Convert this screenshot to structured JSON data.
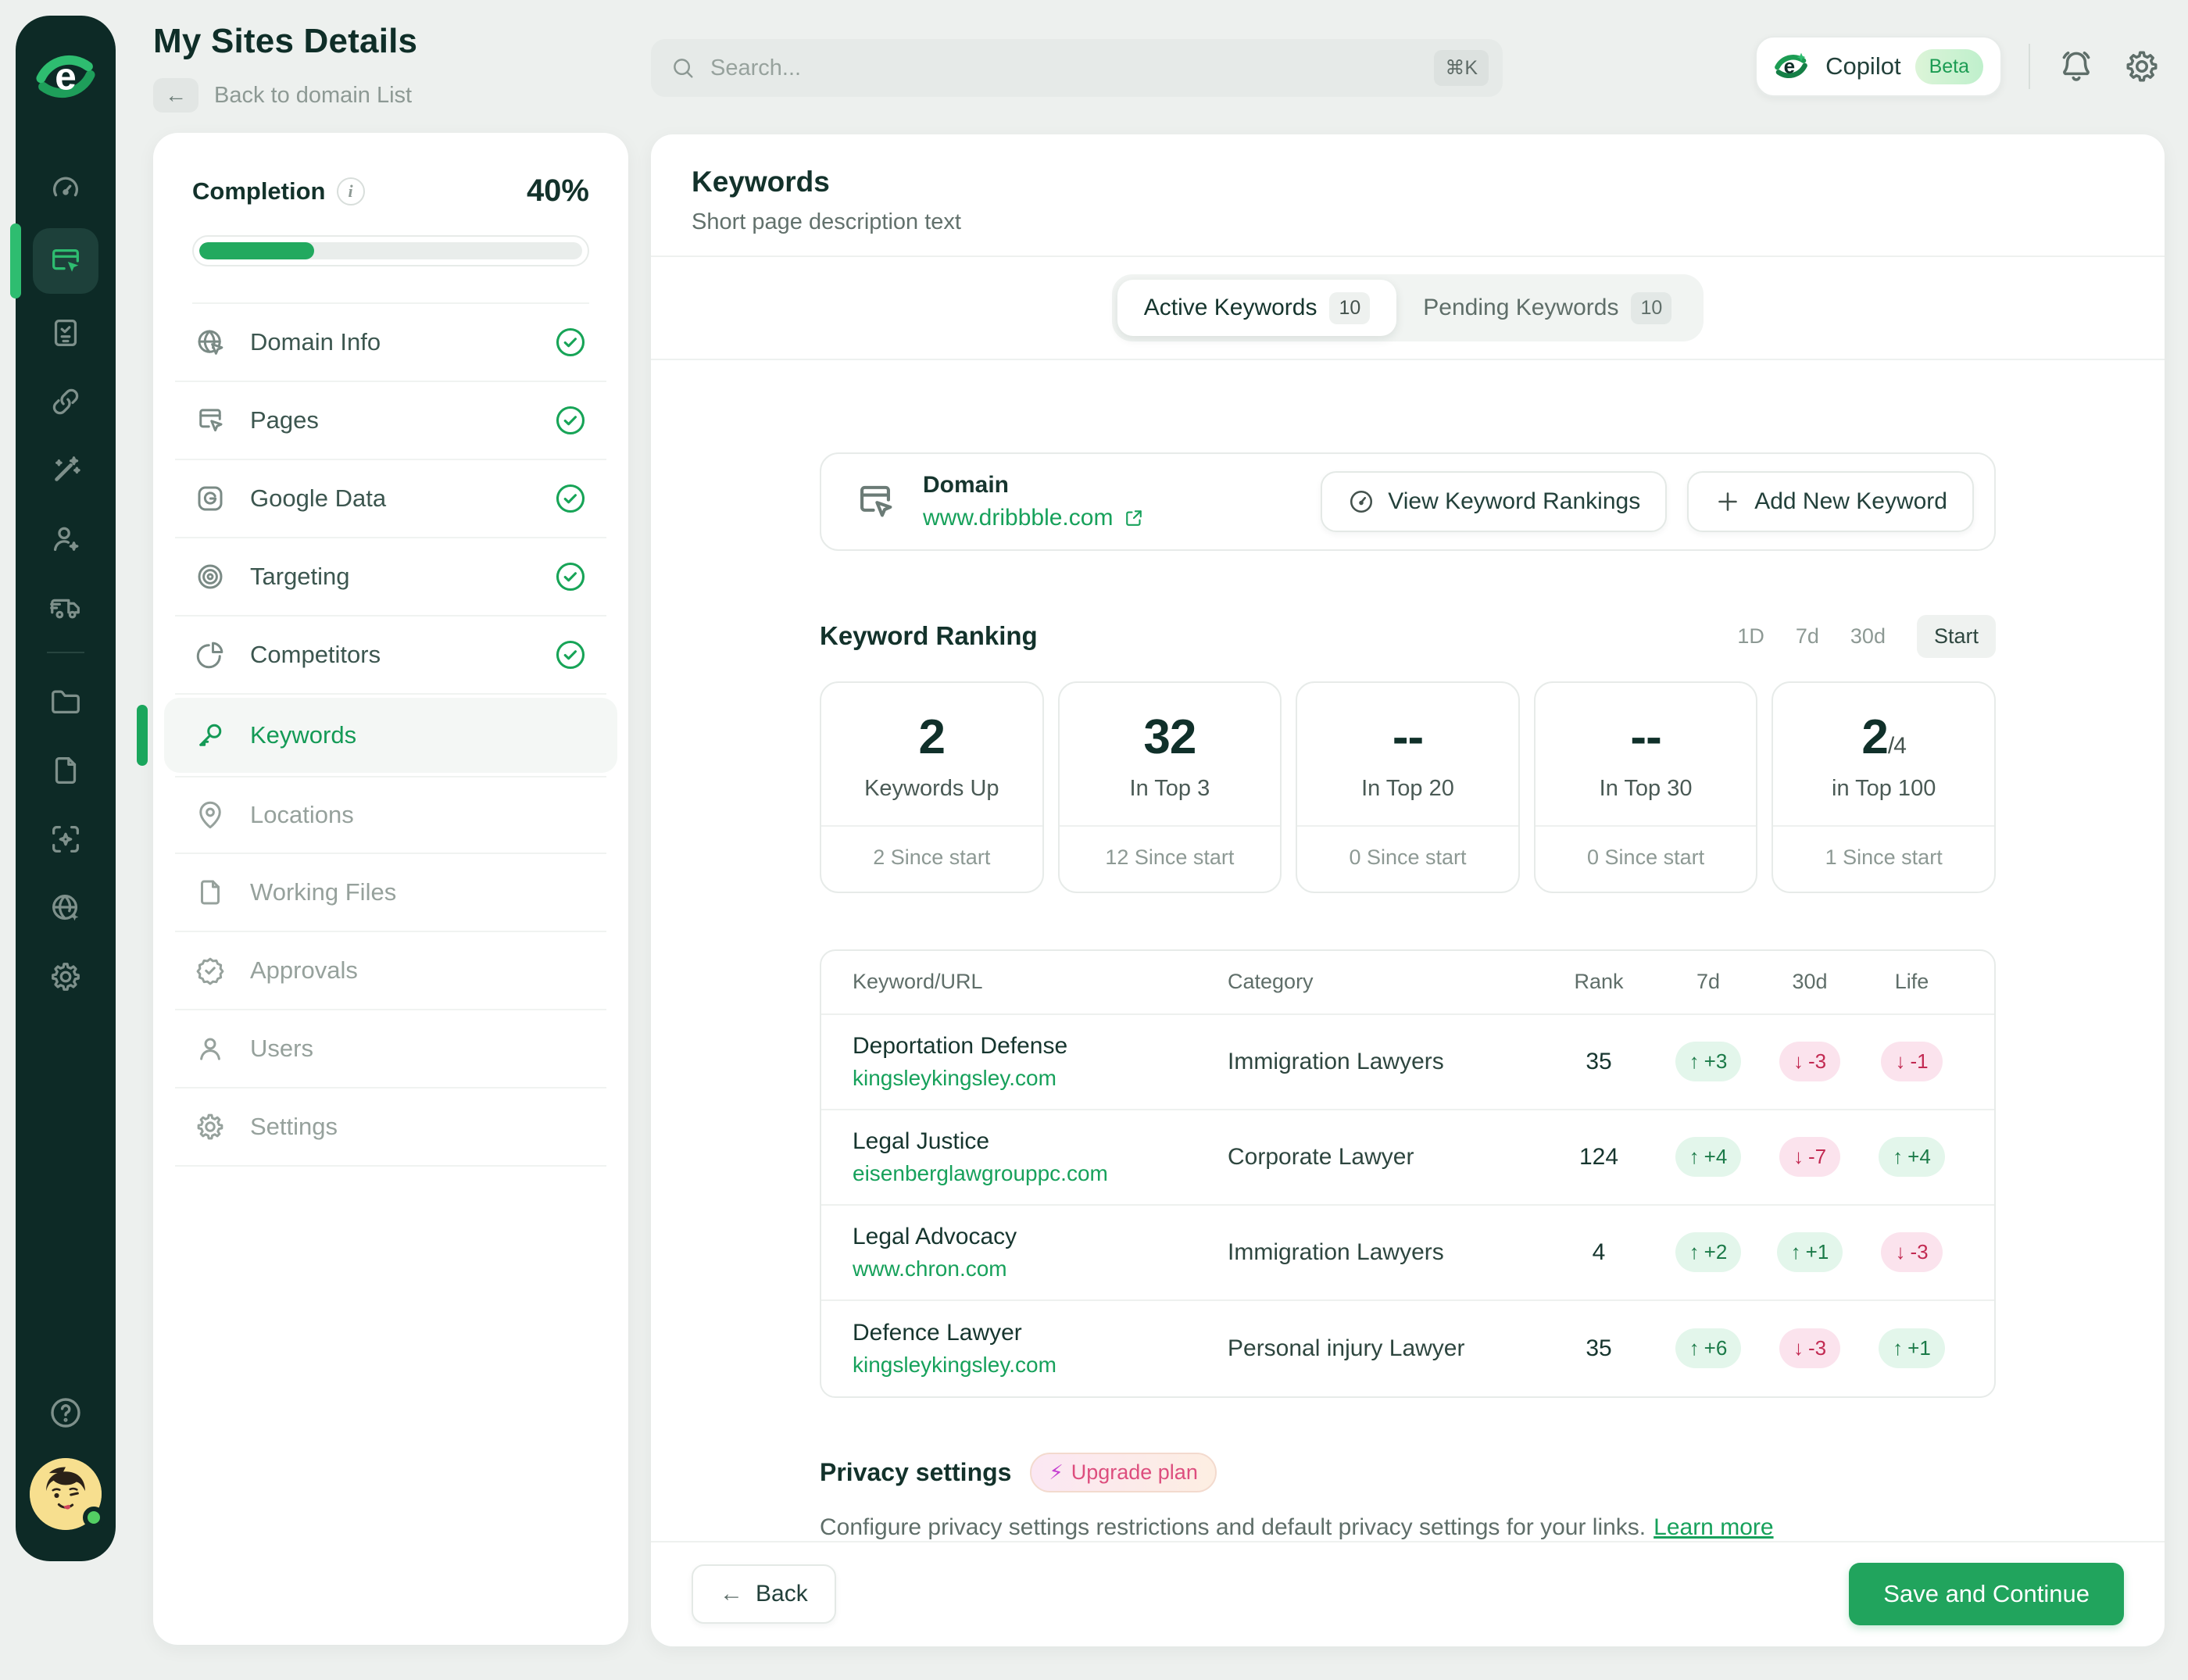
{
  "app": {
    "page_title": "My Sites Details",
    "back_link": "Back to domain List",
    "search": {
      "placeholder": "Search...",
      "shortcut": "⌘K"
    },
    "copilot": {
      "label": "Copilot",
      "badge": "Beta"
    }
  },
  "completion": {
    "label": "Completion",
    "value": "40%",
    "bar_style": "width:30%",
    "info_glyph": "i"
  },
  "site_nav": {
    "items": [
      {
        "label": "Domain Info",
        "icon": "globe-cursor-icon",
        "completed": true
      },
      {
        "label": "Pages",
        "icon": "browser-cursor-icon",
        "completed": true
      },
      {
        "label": "Google Data",
        "icon": "google-icon",
        "completed": true
      },
      {
        "label": "Targeting",
        "icon": "target-icon",
        "completed": true
      },
      {
        "label": "Competitors",
        "icon": "pie-chart-icon",
        "completed": true
      },
      {
        "label": "Keywords",
        "icon": "key-icon",
        "active": true
      },
      {
        "label": "Locations",
        "icon": "map-pin-icon"
      },
      {
        "label": "Working Files",
        "icon": "file-icon"
      },
      {
        "label": "Approvals",
        "icon": "badge-check-icon"
      },
      {
        "label": "Users",
        "icon": "user-icon"
      },
      {
        "label": "Settings",
        "icon": "gear-icon"
      }
    ]
  },
  "main": {
    "title": "Keywords",
    "subtitle": "Short page description text",
    "tabs": [
      {
        "label": "Active Keywords",
        "count": "10",
        "active": true
      },
      {
        "label": "Pending Keywords",
        "count": "10",
        "active": false
      }
    ],
    "domain_card": {
      "label": "Domain",
      "url": "www.dribbble.com",
      "view_button": "View Keyword Rankings",
      "add_button": "Add New Keyword"
    },
    "ranking": {
      "title": "Keyword Ranking",
      "filters": [
        "1D",
        "7d",
        "30d",
        "Start"
      ],
      "active_filter": "Start",
      "stats": [
        {
          "value": "2",
          "suffix": "",
          "label": "Keywords Up",
          "footer": "2 Since start"
        },
        {
          "value": "32",
          "suffix": "",
          "label": "In Top 3",
          "footer": "12 Since start"
        },
        {
          "value": "--",
          "suffix": "",
          "label": "In Top 20",
          "footer": "0 Since start"
        },
        {
          "value": "--",
          "suffix": "",
          "label": "In Top 30",
          "footer": "0 Since start"
        },
        {
          "value": "2",
          "suffix": "/4",
          "label": "in Top 100",
          "footer": "1 Since start"
        }
      ]
    },
    "table": {
      "columns": [
        "Keyword/URL",
        "Category",
        "Rank",
        "7d",
        "30d",
        "Life"
      ],
      "rows": [
        {
          "keyword": "Deportation Defense",
          "url": "kingsleykingsley.com",
          "category": "Immigration Lawyers",
          "rank": "35",
          "d7": {
            "dir": "up",
            "text": "+3"
          },
          "d30": {
            "dir": "down",
            "text": "-3"
          },
          "life": {
            "dir": "down",
            "text": "-1"
          }
        },
        {
          "keyword": "Legal Justice",
          "url": "eisenberglawgrouppc.com",
          "category": "Corporate Lawyer",
          "rank": "124",
          "d7": {
            "dir": "up",
            "text": "+4"
          },
          "d30": {
            "dir": "down",
            "text": "-7"
          },
          "life": {
            "dir": "up",
            "text": "+4"
          }
        },
        {
          "keyword": "Legal Advocacy",
          "url": "www.chron.com",
          "category": "Immigration Lawyers",
          "rank": "4",
          "d7": {
            "dir": "up",
            "text": "+2"
          },
          "d30": {
            "dir": "up",
            "text": "+1"
          },
          "life": {
            "dir": "down",
            "text": "-3"
          }
        },
        {
          "keyword": "Defence Lawyer",
          "url": "kingsleykingsley.com",
          "category": "Personal injury Lawyer",
          "rank": "35",
          "d7": {
            "dir": "up",
            "text": "+6"
          },
          "d30": {
            "dir": "down",
            "text": "-3"
          },
          "life": {
            "dir": "up",
            "text": "+1"
          }
        }
      ]
    },
    "privacy": {
      "title": "Privacy settings",
      "badge": "Upgrade plan",
      "description": "Configure privacy settings restrictions and default privacy settings for your links.",
      "learn_more": "Learn more"
    },
    "footer": {
      "back": "Back",
      "save": "Save and Continue"
    }
  },
  "colors": {
    "accent_green": "#21A45D",
    "bright_green": "#2EBD70",
    "rail_bg": "#0D2A26",
    "page_bg": "#EDF0EE",
    "pill_up_bg": "#E3F6EB",
    "pill_up_text": "#1B7A48",
    "pill_down_bg": "#FBE3ED",
    "pill_down_text": "#C22A52",
    "link_green": "#17A15B"
  },
  "icons": {
    "search": "magnifier",
    "notifications": "bell",
    "settings": "gear",
    "help": "question-circle",
    "completed": "check-circle",
    "external": "external-link"
  }
}
